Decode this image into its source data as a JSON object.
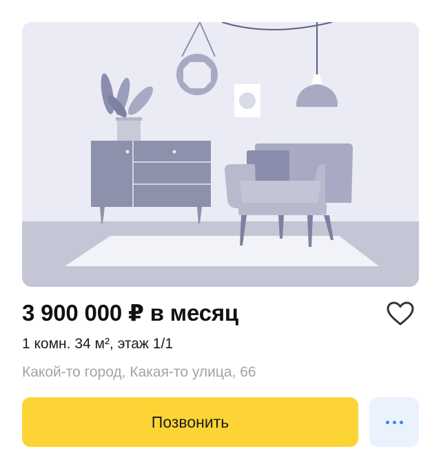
{
  "listing": {
    "image_alt": "Интерьер: комод, кресло, лампа",
    "price": "3 900 000 ₽ в месяц",
    "params": "1 комн. 34 м², этаж 1/1",
    "address": "Какой-то город, Какая-то улица, 66",
    "favorite_icon": "heart-outline-icon",
    "actions": {
      "call_label": "Позвонить",
      "more_icon": "more-dots-icon"
    }
  },
  "colors": {
    "call_button": "#fdd435",
    "more_button_bg": "#eaf2fd",
    "more_dots": "#3b82f6",
    "address_text": "#a3a3a3",
    "photo_wall": "#eaebf4",
    "photo_floor": "#c2c4d4"
  }
}
